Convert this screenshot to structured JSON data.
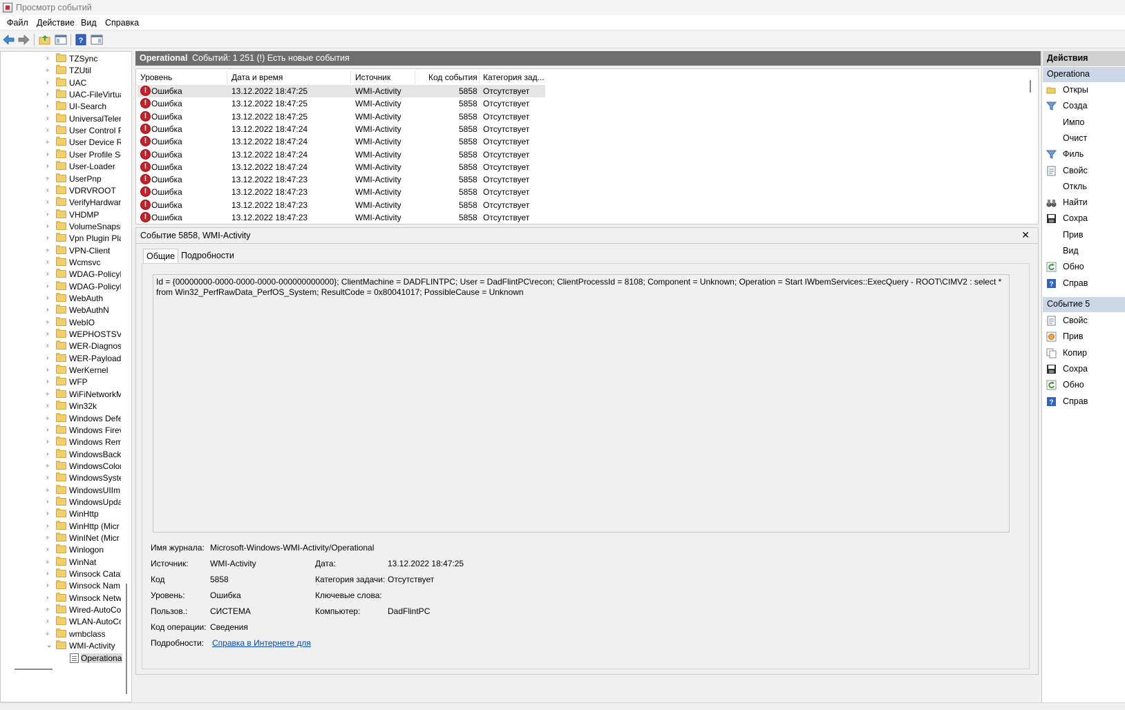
{
  "window": {
    "title": "Просмотр событий"
  },
  "menu": [
    "Файл",
    "Действие",
    "Вид",
    "Справка"
  ],
  "tree": {
    "items": [
      "TZSync",
      "TZUtil",
      "UAC",
      "UAC-FileVirtua",
      "UI-Search",
      "UniversalTelem",
      "User Control P",
      "User Device Re",
      "User Profile Se",
      "User-Loader",
      "UserPnp",
      "VDRVROOT",
      "VerifyHardwar",
      "VHDMP",
      "VolumeSnapsh",
      "Vpn Plugin Pla",
      "VPN-Client",
      "Wcmsvc",
      "WDAG-PolicyE",
      "WDAG-PolicyE",
      "WebAuth",
      "WebAuthN",
      "WebIO",
      "WEPHOSTSVC",
      "WER-Diagnost",
      "WER-PayloadH",
      "WerKernel",
      "WFP",
      "WiFiNetworkM",
      "Win32k",
      "Windows Defe",
      "Windows Firev",
      "Windows Rem",
      "WindowsBacku",
      "WindowsColor",
      "WindowsSyste",
      "WindowsUIIm",
      "WindowsUpda",
      "WinHttp",
      "WinHttp (Micr",
      "WinINet (Micr",
      "Winlogon",
      "WinNat",
      "Winsock Catal",
      "Winsock Nam",
      "Winsock Netw",
      "Wired-AutoCo",
      "WLAN-AutoCo",
      "wmbclass",
      "WMI-Activity"
    ],
    "selected_child": "Operationa"
  },
  "center": {
    "log_name": "Operational",
    "summary": "Событий: 1 251 (!) Есть новые события"
  },
  "columns": [
    "Уровень",
    "Дата и время",
    "Источник",
    "Код события",
    "Категория зад..."
  ],
  "events": [
    {
      "level": "Ошибка",
      "date": "13.12.2022 18:47:25",
      "source": "WMI-Activity",
      "id": "5858",
      "category": "Отсутствует"
    },
    {
      "level": "Ошибка",
      "date": "13.12.2022 18:47:25",
      "source": "WMI-Activity",
      "id": "5858",
      "category": "Отсутствует"
    },
    {
      "level": "Ошибка",
      "date": "13.12.2022 18:47:25",
      "source": "WMI-Activity",
      "id": "5858",
      "category": "Отсутствует"
    },
    {
      "level": "Ошибка",
      "date": "13.12.2022 18:47:24",
      "source": "WMI-Activity",
      "id": "5858",
      "category": "Отсутствует"
    },
    {
      "level": "Ошибка",
      "date": "13.12.2022 18:47:24",
      "source": "WMI-Activity",
      "id": "5858",
      "category": "Отсутствует"
    },
    {
      "level": "Ошибка",
      "date": "13.12.2022 18:47:24",
      "source": "WMI-Activity",
      "id": "5858",
      "category": "Отсутствует"
    },
    {
      "level": "Ошибка",
      "date": "13.12.2022 18:47:24",
      "source": "WMI-Activity",
      "id": "5858",
      "category": "Отсутствует"
    },
    {
      "level": "Ошибка",
      "date": "13.12.2022 18:47:23",
      "source": "WMI-Activity",
      "id": "5858",
      "category": "Отсутствует"
    },
    {
      "level": "Ошибка",
      "date": "13.12.2022 18:47:23",
      "source": "WMI-Activity",
      "id": "5858",
      "category": "Отсутствует"
    },
    {
      "level": "Ошибка",
      "date": "13.12.2022 18:47:23",
      "source": "WMI-Activity",
      "id": "5858",
      "category": "Отсутствует"
    },
    {
      "level": "Ошибка",
      "date": "13.12.2022 18:47:23",
      "source": "WMI-Activity",
      "id": "5858",
      "category": "Отсутствует"
    }
  ],
  "detail": {
    "title": "Событие 5858, WMI-Activity",
    "close": "✕",
    "tabs": [
      "Общие",
      "Подробности"
    ],
    "message": "Id = {00000000-0000-0000-0000-000000000000}; ClientMachine = DADFLINTPC; User = DadFlintPC\\recon; ClientProcessId = 8108; Component = Unknown; Operation = Start IWbemServices::ExecQuery - ROOT\\CIMV2 : select * from Win32_PerfRawData_PerfOS_System; ResultCode = 0x80041017; PossibleCause = Unknown",
    "fields": {
      "log_name_label": "Имя журнала:",
      "log_name": "Microsoft-Windows-WMI-Activity/Operational",
      "source_label": "Источник:",
      "source": "WMI-Activity",
      "date_label": "Дата:",
      "date": "13.12.2022 18:47:25",
      "code_label": "Код",
      "code": "5858",
      "category_label": "Категория задачи:",
      "category": "Отсутствует",
      "level_label": "Уровень:",
      "level": "Ошибка",
      "keywords_label": "Ключевые слова:",
      "user_label": "Пользов.:",
      "user": "СИСТЕМА",
      "computer_label": "Компьютер:",
      "computer": "DadFlintPC",
      "opcode_label": "Код операции:",
      "opcode": "Сведения",
      "more_label": "Подробности:",
      "more_link": "Справка в Интернете для"
    }
  },
  "actions": {
    "header": "Действия",
    "group1_header": "Operationa",
    "group1": [
      "Откры",
      "Созда",
      "Импо",
      "Очист",
      "Филь",
      "Свойс",
      "Откль",
      "Найти",
      "Сохра",
      "Прив",
      "Вид",
      "Обно",
      "Справ"
    ],
    "group2_header": "Событие 5",
    "group2": [
      "Свойс",
      "Прив",
      "Копир",
      "Сохра",
      "Обно",
      "Справ"
    ]
  }
}
